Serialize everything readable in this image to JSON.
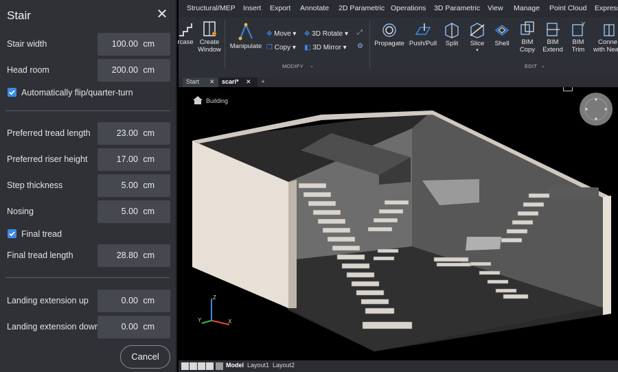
{
  "dialog": {
    "title": "Stair",
    "rows": {
      "stair_width": {
        "label": "Stair width",
        "value": "100.00",
        "unit": "cm"
      },
      "head_room": {
        "label": "Head room",
        "value": "200.00",
        "unit": "cm"
      },
      "tread_length": {
        "label": "Preferred tread length",
        "value": "23.00",
        "unit": "cm"
      },
      "riser_height": {
        "label": "Preferred riser height",
        "value": "17.00",
        "unit": "cm"
      },
      "step_thickness": {
        "label": "Step thickness",
        "value": "5.00",
        "unit": "cm"
      },
      "nosing": {
        "label": "Nosing",
        "value": "5.00",
        "unit": "cm"
      },
      "final_tread_length": {
        "label": "Final tread length",
        "value": "28.80",
        "unit": "cm"
      },
      "landing_up": {
        "label": "Landing extension up",
        "value": "0.00",
        "unit": "cm"
      },
      "landing_down": {
        "label": "Landing extension down",
        "value": "0.00",
        "unit": "cm"
      }
    },
    "auto_flip": {
      "label": "Automatically flip/quarter-turn",
      "checked": true
    },
    "final_tread": {
      "label": "Final tread",
      "checked": true
    },
    "cancel_label": "Cancel",
    "accent": "#3b8be6"
  },
  "ribbon": {
    "menu": [
      "Structural/MEP",
      "Insert",
      "Export",
      "Annotate",
      "2D Parametric",
      "Operations",
      "3D Parametric",
      "View",
      "Manage",
      "Point Cloud",
      "Express"
    ],
    "tools": {
      "staircase": "rcase",
      "create_window": [
        "Create",
        "Window"
      ],
      "manipulate": "Manipulate",
      "move": "Move",
      "copy": "Copy",
      "rotate3d": "3D Rotate",
      "mirror3d": "3D Mirror",
      "propagate": "Propagate",
      "pushpull": "Push/Pull",
      "split": "Split",
      "slice": "Slice",
      "shell": "Shell",
      "bim_copy": [
        "BIM",
        "Copy"
      ],
      "bim_extend": [
        "BIM",
        "Extend"
      ],
      "bim_trim": [
        "BIM",
        "Trim"
      ],
      "connect": [
        "Conne",
        "with Nea"
      ]
    },
    "groups": {
      "modify": "MODIFY",
      "edit": "EDIT"
    }
  },
  "tabs": {
    "start": "Start",
    "active": "scari*",
    "add": "+"
  },
  "viewport": {
    "building_label": "Building",
    "axes": {
      "x": "X",
      "y": "Y",
      "z": "Z"
    }
  },
  "layout_tabs": [
    "Model",
    "Layout1",
    "Layout2"
  ]
}
